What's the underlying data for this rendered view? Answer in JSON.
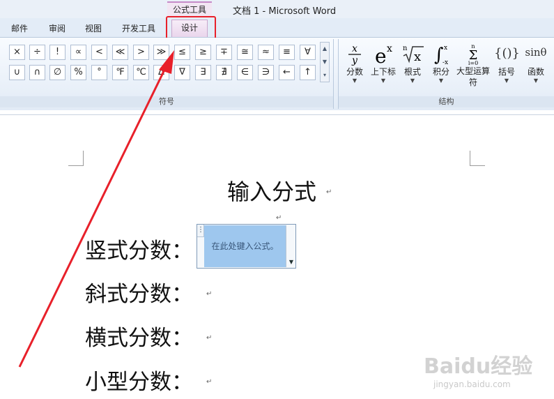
{
  "window": {
    "context_tools_label": "公式工具",
    "doc_title": "文档 1 - Microsoft Word"
  },
  "tabs": [
    {
      "label": "邮件"
    },
    {
      "label": "审阅"
    },
    {
      "label": "视图"
    },
    {
      "label": "开发工具"
    },
    {
      "label": "设计"
    }
  ],
  "ribbon": {
    "symbols_group_label": "符号",
    "symbols": [
      "×",
      "÷",
      "!",
      "∝",
      "<",
      "≪",
      ">",
      "≫",
      "≤",
      "≥",
      "∓",
      "≅",
      "≈",
      "≡",
      "∀",
      "∪",
      "∩",
      "∅",
      "%",
      "°",
      "℉",
      "℃",
      "∆",
      "∇",
      "∃",
      "∄",
      "∈",
      "∋",
      "←",
      "↑"
    ],
    "structures_group_label": "结构",
    "structures": [
      {
        "icon": "fraction-icon",
        "label": "分数"
      },
      {
        "icon": "script-icon",
        "label": "上下标"
      },
      {
        "icon": "radical-icon",
        "label": "根式"
      },
      {
        "icon": "integral-icon",
        "label": "积分"
      },
      {
        "icon": "large-operator-icon",
        "label": "大型运算符"
      },
      {
        "icon": "bracket-icon",
        "label": "括号",
        "glyph": "{()}"
      },
      {
        "icon": "function-icon",
        "label": "函数",
        "glyph": "sinθ"
      }
    ]
  },
  "document": {
    "heading": "输入分式",
    "rows": [
      {
        "label": "竖式分数："
      },
      {
        "label": "斜式分数："
      },
      {
        "label": "横式分数："
      },
      {
        "label": "小型分数："
      }
    ],
    "equation_placeholder": "在此处键入公式。",
    "paragraph_mark": "↵"
  },
  "watermark": {
    "brand": "Baidu经验",
    "url": "jingyan.baidu.com"
  },
  "colors": {
    "highlight_border": "#e8202a",
    "annotation_arrow": "#e8202a",
    "equation_selection": "#9ec7ee",
    "design_tab": "#ead6ec"
  }
}
